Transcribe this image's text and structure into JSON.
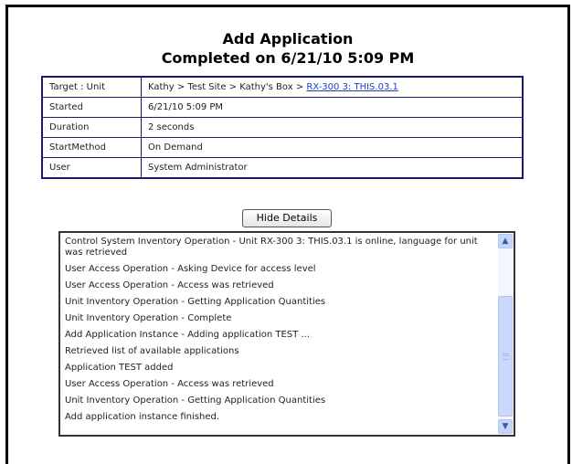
{
  "header": {
    "title": "Add Application",
    "subtitle": "Completed on 6/21/10 5:09 PM"
  },
  "details": {
    "rows": [
      {
        "label": "Target : Unit",
        "value": "Kathy > Test Site > Kathy's Box > ",
        "link": "RX-300 3: THIS.03.1"
      },
      {
        "label": "Started",
        "value": "6/21/10 5:09 PM"
      },
      {
        "label": "Duration",
        "value": "2 seconds"
      },
      {
        "label": "StartMethod",
        "value": "On Demand"
      },
      {
        "label": "User",
        "value": "System Administrator"
      }
    ]
  },
  "toggle_button": {
    "label": "Hide Details"
  },
  "log": {
    "lines": [
      "Control System Inventory Operation - Unit RX-300 3: THIS.03.1 is online, language for unit was retrieved",
      "User Access Operation - Asking Device for access level",
      "User Access Operation - Access was retrieved",
      "Unit Inventory Operation - Getting Application Quantities",
      "Unit Inventory Operation - Complete",
      "Add Application Instance - Adding application TEST ...",
      "Retrieved list of available applications",
      "Application TEST added",
      "User Access Operation - Access was retrieved",
      "Unit Inventory Operation - Getting Application Quantities",
      "Add application instance finished."
    ]
  },
  "scrollbar": {
    "up_icon": "chevron-up-icon",
    "down_icon": "chevron-down-icon",
    "up_glyph": "▲",
    "down_glyph": "▼"
  }
}
